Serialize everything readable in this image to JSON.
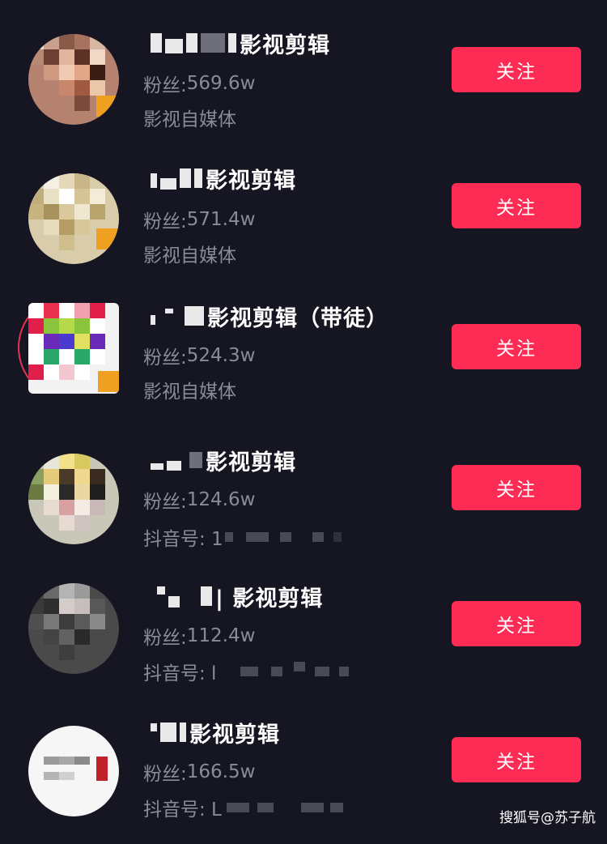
{
  "items": [
    {
      "name_suffix": "影视剪辑",
      "fans_label": "粉丝:",
      "fans_value": "569.6w",
      "tag": "影视自媒体",
      "button_label": "关注",
      "colors": {
        "avatar_main": "#b4826e",
        "avatar_accent": "#f0a020"
      }
    },
    {
      "name_suffix": "影视剪辑",
      "fans_label": "粉丝:",
      "fans_value": "571.4w",
      "tag": "影视自媒体",
      "button_label": "关注",
      "colors": {
        "avatar_main": "#d9ccaa",
        "avatar_accent": "#f0a020"
      }
    },
    {
      "name_suffix": "影视剪辑（带徒）",
      "fans_label": "粉丝:",
      "fans_value": "524.3w",
      "tag": "影视自媒体",
      "button_label": "关注",
      "colors": {
        "avatar_main": "#f2f2f2",
        "avatar_accent": "#e0204a"
      }
    },
    {
      "name_suffix": "影视剪辑",
      "fans_label": "粉丝:",
      "fans_value": "124.6w",
      "tag": "抖音号: 1",
      "button_label": "关注",
      "colors": {
        "avatar_main": "#c9c7b8",
        "avatar_accent": "#6a7a40"
      }
    },
    {
      "name_suffix": "| 影视剪辑",
      "fans_label": "粉丝:",
      "fans_value": "112.4w",
      "tag": "抖音号: l",
      "button_label": "关注",
      "colors": {
        "avatar_main": "#4a4a4a",
        "avatar_accent": "#8a8a8a"
      }
    },
    {
      "name_suffix": "影视剪辑",
      "fans_label": "粉丝:",
      "fans_value": "166.5w",
      "tag": "抖音号: L",
      "button_label": "关注",
      "colors": {
        "avatar_main": "#f6f6f6",
        "avatar_accent": "#c0202a"
      }
    }
  ],
  "watermark": "搜狐号@苏子航",
  "colors": {
    "background": "#161622",
    "button": "#fe2c55",
    "secondary_text": "#8b8b96"
  }
}
